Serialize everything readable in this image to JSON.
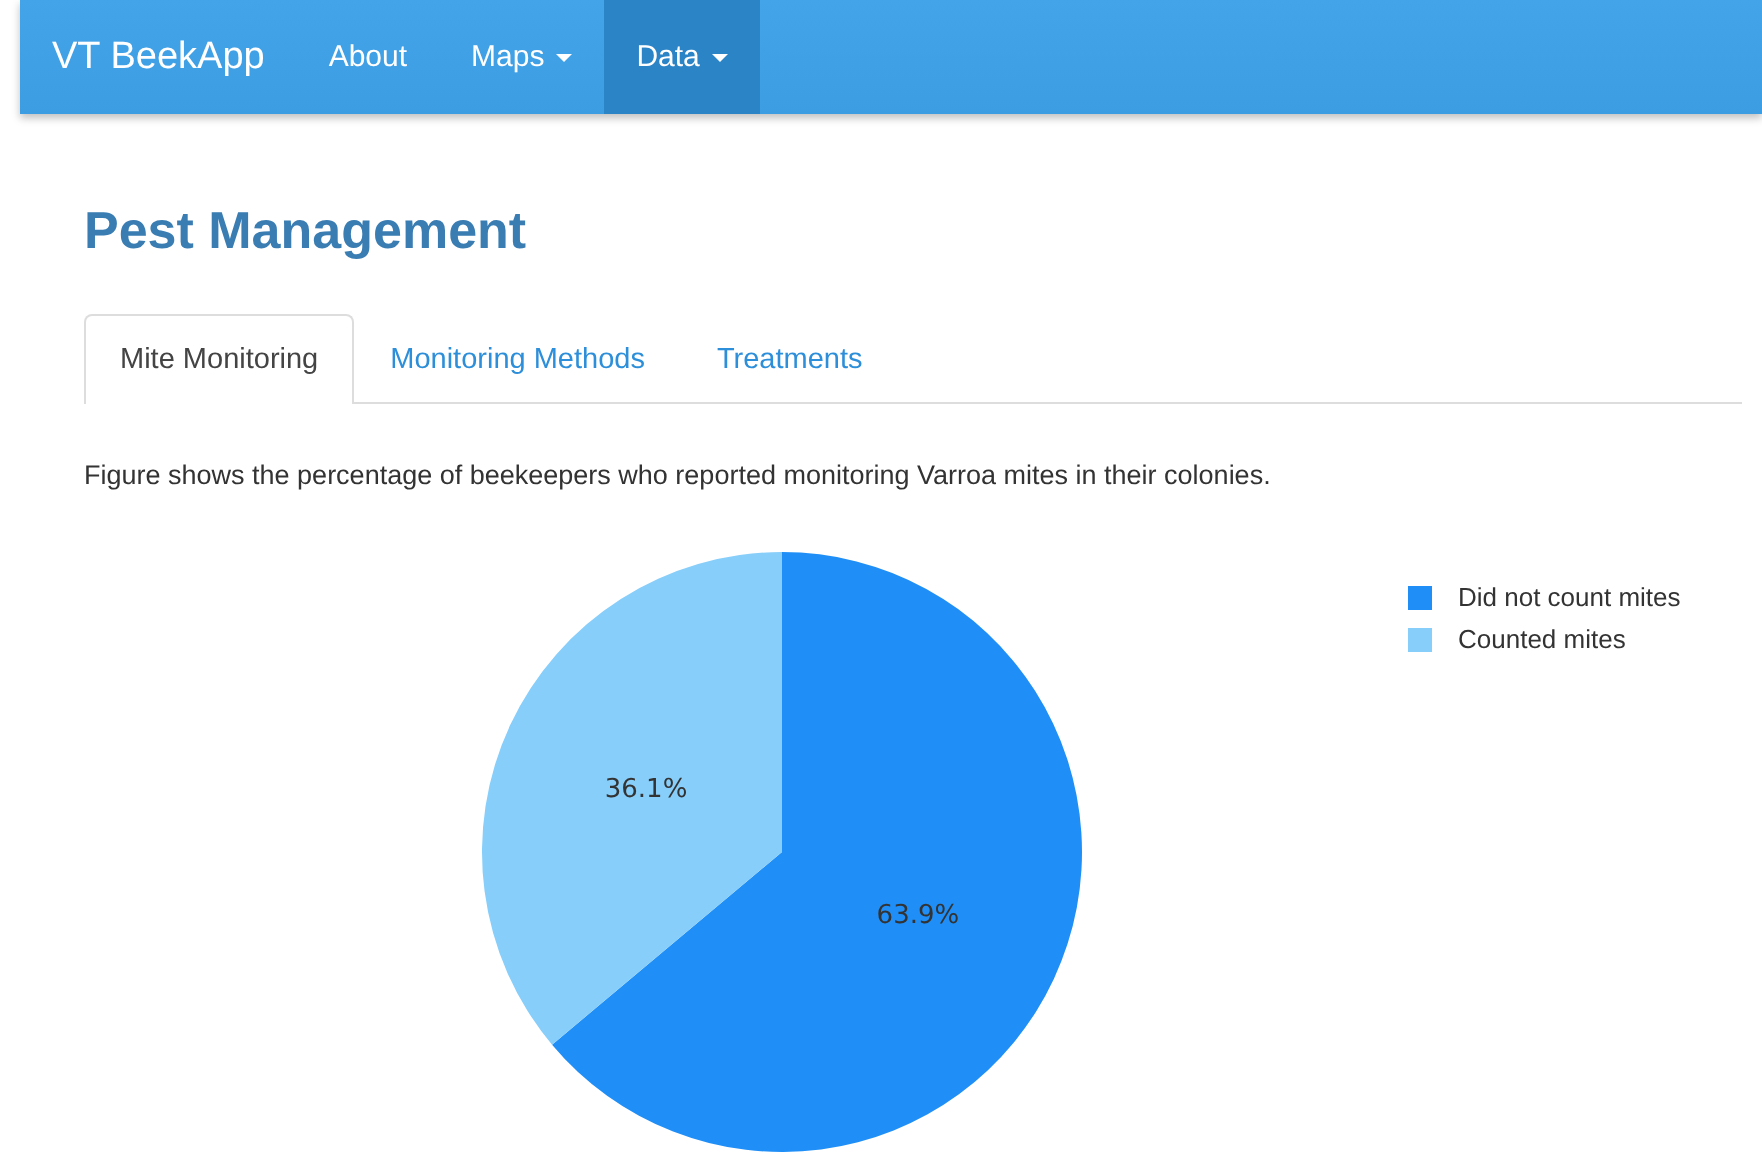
{
  "navbar": {
    "brand": "VT BeekApp",
    "items": [
      {
        "label": "About",
        "dropdown": false,
        "selected": false
      },
      {
        "label": "Maps",
        "dropdown": true,
        "selected": false
      },
      {
        "label": "Data",
        "dropdown": true,
        "selected": true
      }
    ]
  },
  "page_title": "Pest Management",
  "tabs": [
    {
      "label": "Mite Monitoring",
      "selected": true
    },
    {
      "label": "Monitoring Methods",
      "selected": false
    },
    {
      "label": "Treatments",
      "selected": false
    }
  ],
  "description": "Figure shows the percentage of beekeepers who reported monitoring Varroa mites in their colonies.",
  "chart_data": {
    "type": "pie",
    "categories": [
      "Did not count mites",
      "Counted mites"
    ],
    "values": [
      63.9,
      36.1
    ],
    "colors": [
      "#1f8ff7",
      "#87cefa"
    ],
    "value_labels": [
      "63.9%",
      "36.1%"
    ],
    "legend": "right"
  }
}
